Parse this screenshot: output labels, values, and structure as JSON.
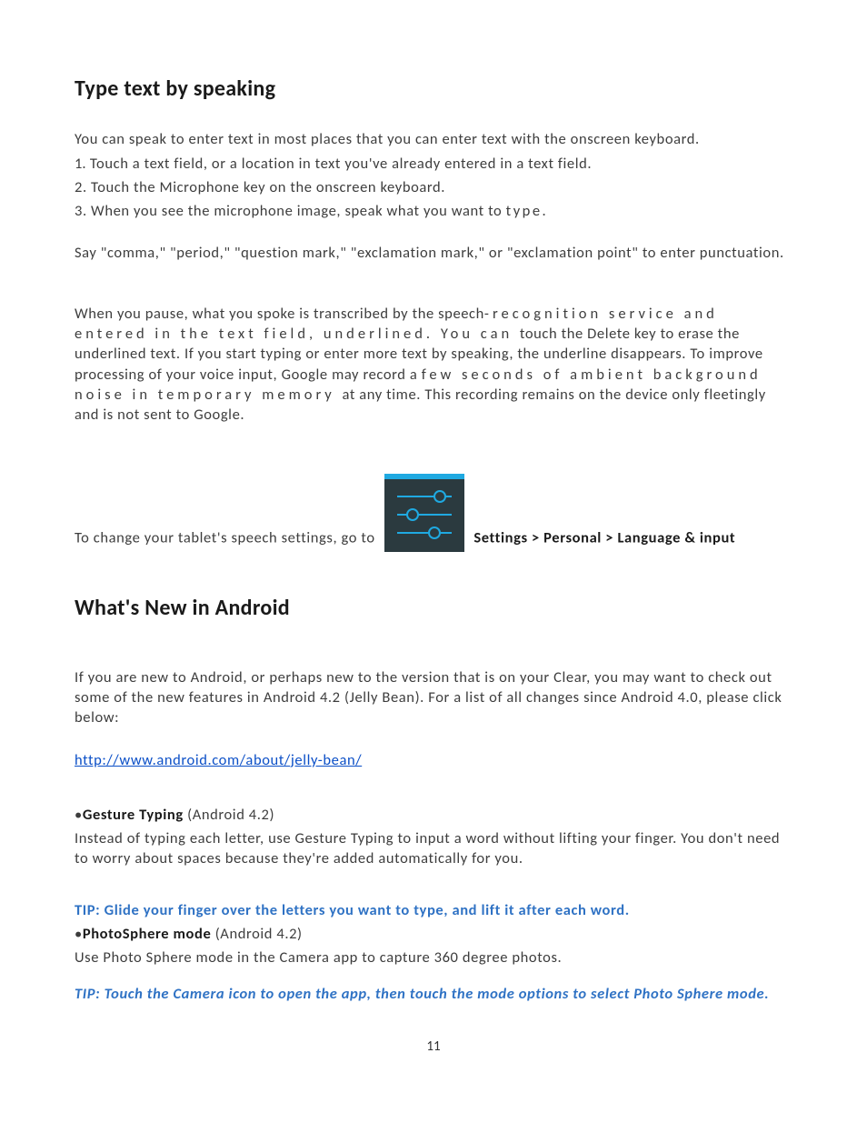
{
  "section1": {
    "heading": "Type text by speaking",
    "intro": "You can speak to enter text in most places that you can enter text with the onscreen keyboard.",
    "step1_prefix": "1.",
    "step1": "Touch a text field, or a location in text you've already entered in a text field.",
    "step2": "2. Touch the Microphone key on the onscreen keyboard.",
    "step3_a": "3. When you see the microphone image, speak what you want to ",
    "step3_b": "type.",
    "punctuation": "Say \"comma,\"  \"period,\"  \"question mark,\"  \"exclamation mark,\" or \"exclamation point\" to enter punctuation.",
    "transcribe_a": "When you pause, what you spoke is transcribed by the speech",
    "transcribe_b": "-recognition service and entered in the text field, underlined. You can ",
    "transcribe_c": "touch the Delete key to erase the underlined text. If you start typing or enter more text by speaking, the underline disappears. To improve processing of your voice input, Google may record a ",
    "transcribe_d": "few seconds of ambient background noise in temporary memory ",
    "transcribe_e": "at any time. This recording remains on the device only fleetingly and is not sent to Google.",
    "settings_before": "To change your tablet's speech settings, go to ",
    "settings_path": "Settings > Personal > Language & input"
  },
  "section2": {
    "heading": "What's New in Android",
    "intro": "If you are new to Android, or perhaps new to the version that is on your Clear, you may want to check out some of the new features in Android 4.2 (Jelly Bean). For a list of all changes since Android 4.0, please click below:",
    "link": "http://www.android.com/about/jelly-bean/",
    "feature1_title": "Gesture Typing",
    "feature1_version": " (Android 4.2)",
    "feature1_body": "Instead of typing each letter, use Gesture Typing to input a word without lifting your finger. You don't need to worry about spaces because they're added automatically for you.",
    "tip1": "TIP: Glide your finger over the letters you want to type, and lift it after each word.",
    "feature2_title": "PhotoSphere mode",
    "feature2_version": " (Android 4.2)",
    "feature2_body": "Use Photo Sphere mode in the Camera app to capture 360 degree photos.",
    "tip2": "TIP: Touch the Camera icon to open the app, then touch the mode options to select Photo Sphere mode."
  },
  "page_number": "11"
}
